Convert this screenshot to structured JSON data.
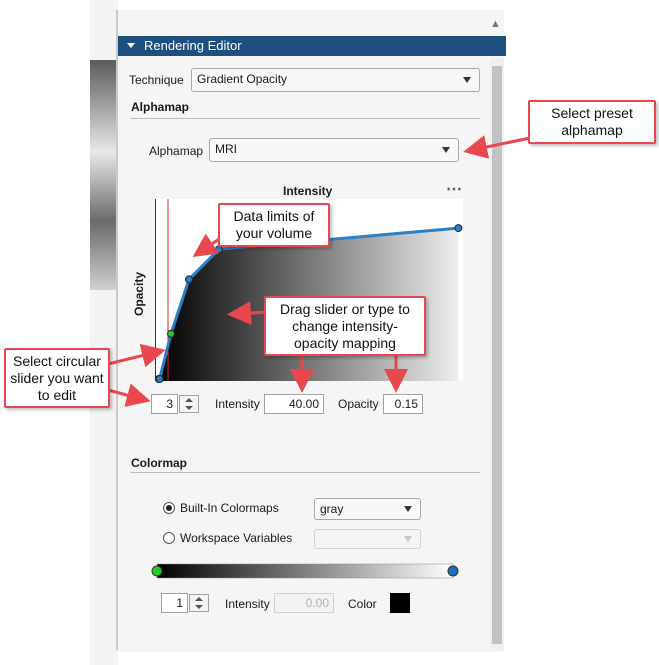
{
  "panel": {
    "title": "Rendering Editor",
    "technique_label": "Technique",
    "technique_value": "Gradient Opacity"
  },
  "alphamap": {
    "section_title": "Alphamap",
    "label": "Alphamap",
    "value": "MRI",
    "plot_title": "Intensity",
    "y_label": "Opacity",
    "more_icon": "⋯",
    "point_index": "3",
    "intensity_label": "Intensity",
    "intensity_value": "40.00",
    "opacity_label": "Opacity",
    "opacity_value": "0.15"
  },
  "colormap": {
    "section_title": "Colormap",
    "builtin_label": "Built-In Colormaps",
    "builtin_value": "gray",
    "workspace_label": "Workspace Variables",
    "workspace_value": "",
    "point_index": "1",
    "intensity_label": "Intensity",
    "intensity_value": "0.00",
    "color_label": "Color",
    "swatch_color": "#000000"
  },
  "callouts": {
    "preset": "Select preset alphamap",
    "limits": "Data limits of your volume",
    "drag": "Drag slider or type to change intensity-opacity mapping",
    "select": "Select circular slider you want to edit"
  },
  "colors": {
    "header": "#1e4f7f",
    "curve": "#2a7fc8",
    "limit_line": "#e02020",
    "callout_border": "#e8484d",
    "selected_point": "#22cc22",
    "colormap_end": "#1f6fc0"
  },
  "alphamap_points": [
    {
      "intensity": 0,
      "opacity": 0
    },
    {
      "intensity": 2,
      "opacity": 0
    },
    {
      "intensity": 40,
      "opacity": 0.15
    },
    {
      "intensity": 100,
      "opacity": 0.33
    },
    {
      "intensity": 200,
      "opacity": 0.43
    },
    {
      "intensity": 998,
      "opacity": 0.5
    }
  ]
}
